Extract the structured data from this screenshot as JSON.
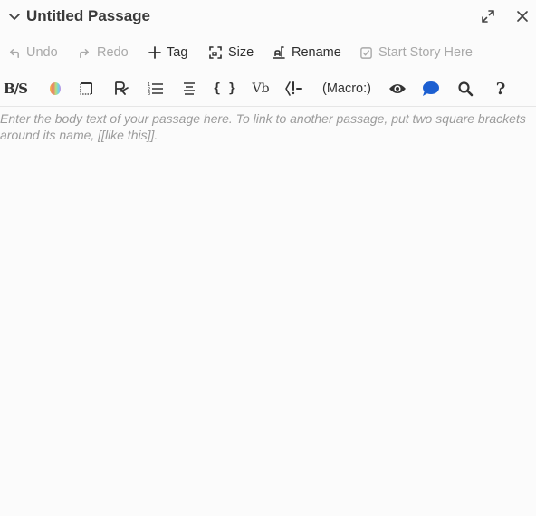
{
  "header": {
    "title": "Untitled Passage"
  },
  "actions": {
    "undo": "Undo",
    "redo": "Redo",
    "tag": "Tag",
    "size": "Size",
    "rename": "Rename",
    "start_story": "Start Story Here"
  },
  "format_toolbar": {
    "bold_strike_glyph": "B/S",
    "align_glyph": "{ }",
    "vb_glyph": "Vb",
    "macro_label": "(Macro:)",
    "help_glyph": "?",
    "icons": [
      "bold-italic-strike-icon",
      "color-icon",
      "border-icon",
      "text-style-icon",
      "list-icon",
      "align-icon",
      "hook-brackets-icon",
      "variable-icon",
      "control-flow-icon",
      "macro-button",
      "eye-icon",
      "comment-icon",
      "search-icon",
      "help-icon"
    ]
  },
  "editor": {
    "placeholder": "Enter the body text of your passage here. To link to another passage, put two square brackets around its name, [[like this]]."
  },
  "colors": {
    "accent_blue": "#1c5fd1",
    "disabled_text": "#a9a9a9",
    "placeholder_text": "#9b9b9b"
  }
}
